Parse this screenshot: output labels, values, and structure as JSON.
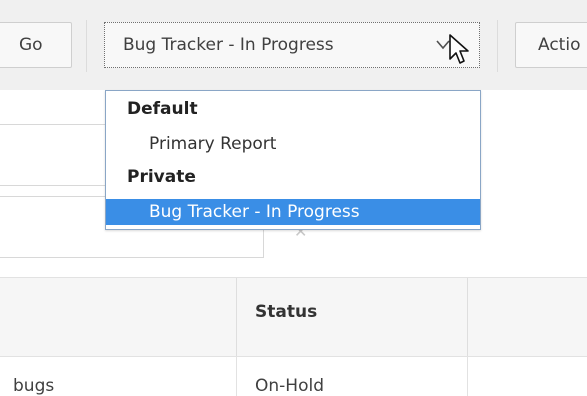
{
  "toolbar": {
    "go_label": "Go",
    "actions_label": "Actio",
    "report_select": {
      "selected": "Bug Tracker - In Progress",
      "chevron_icon": "chevron-down-icon",
      "cursor_icon": "mouse-pointer-icon"
    }
  },
  "dropdown": {
    "groups": [
      {
        "label": "Default",
        "options": [
          "Primary Report"
        ]
      },
      {
        "label": "Private",
        "options": [
          "Bug Tracker - In Progress"
        ]
      }
    ],
    "selected_option": "Bug Tracker - In Progress",
    "highlight_color": "#3a8ee6"
  },
  "table": {
    "headers": [
      "",
      "Status"
    ],
    "rows": [
      [
        "bugs",
        "On-Hold"
      ]
    ]
  }
}
